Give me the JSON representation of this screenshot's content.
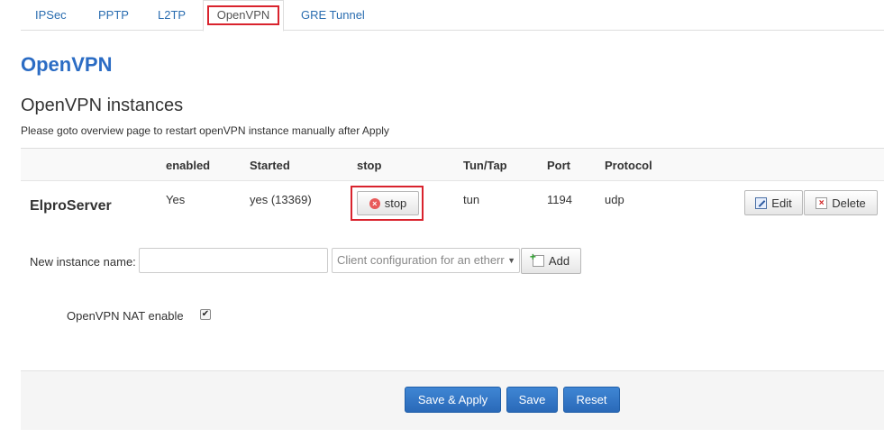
{
  "tabs": [
    {
      "label": "IPSec"
    },
    {
      "label": "PPTP"
    },
    {
      "label": "L2TP"
    },
    {
      "label": "OpenVPN"
    },
    {
      "label": "GRE Tunnel"
    }
  ],
  "page_title": "OpenVPN",
  "section": {
    "title": "OpenVPN instances",
    "description": "Please goto overview page to restart openVPN instance manually after Apply"
  },
  "table": {
    "headers": [
      "enabled",
      "Started",
      "stop",
      "Tun/Tap",
      "Port",
      "Protocol"
    ],
    "rows": [
      {
        "name": "ElproServer",
        "enabled": "Yes",
        "started": "yes (13369)",
        "stop_label": "stop",
        "tuntap": "tun",
        "port": "1194",
        "protocol": "udp",
        "edit_label": "Edit",
        "delete_label": "Delete"
      }
    ]
  },
  "new_instance": {
    "label": "New instance name:",
    "value": "",
    "select_value": "Client configuration for an etherr",
    "add_label": "Add"
  },
  "nat": {
    "label": "OpenVPN NAT enable",
    "checked": true
  },
  "footer": {
    "save_apply": "Save & Apply",
    "save": "Save",
    "reset": "Reset"
  },
  "colors": {
    "link": "#2a6db0",
    "title": "#2b6cc4",
    "primary": "#2a69b8",
    "highlight": "#d9232d"
  }
}
